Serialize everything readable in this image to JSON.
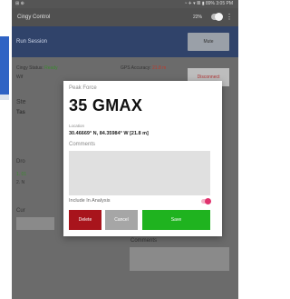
{
  "statusbar": {
    "left": "⊞ ⊕",
    "time": "◔ ✈ ▾ 𝌆 ▮ 89% 3:05 PM"
  },
  "appbar": {
    "title": "Cingy Control",
    "battery": "22%",
    "menu": "⋮"
  },
  "session": {
    "title": "Run Session",
    "mute_label": "Mute"
  },
  "status": {
    "connection_prefix": "Cingy Status:",
    "connection_value": "Ready",
    "gps_prefix": "GPS Accuracy:",
    "gps_value": "21.8 m",
    "disconnect_label": "Disconnect",
    "wifi_text": "Wif"
  },
  "background": {
    "session_label": "Ste",
    "session_sub": "Tas",
    "drop_label": "Dro",
    "list_1": "1. 01",
    "list_2": "2. N",
    "comments_label": "Comments",
    "cur_label": "Cur"
  },
  "modal": {
    "peak_force_label": "Peak Force",
    "peak_force_value": "35 GMAX",
    "location_label": "Location",
    "location_value": "30.46669° N, 84.35984° W [21.8 m]",
    "comments_label": "Comments",
    "include_label": "Include In Analysis",
    "include_checked": true,
    "delete_label": "Delete",
    "cancel_label": "Cancel",
    "save_label": "Save"
  },
  "colors": {
    "delete": "#a8141c",
    "cancel": "#a6a6a6",
    "save": "#1fb31f",
    "toggle_on": "#e0326d",
    "session_bar": "#30436a"
  }
}
